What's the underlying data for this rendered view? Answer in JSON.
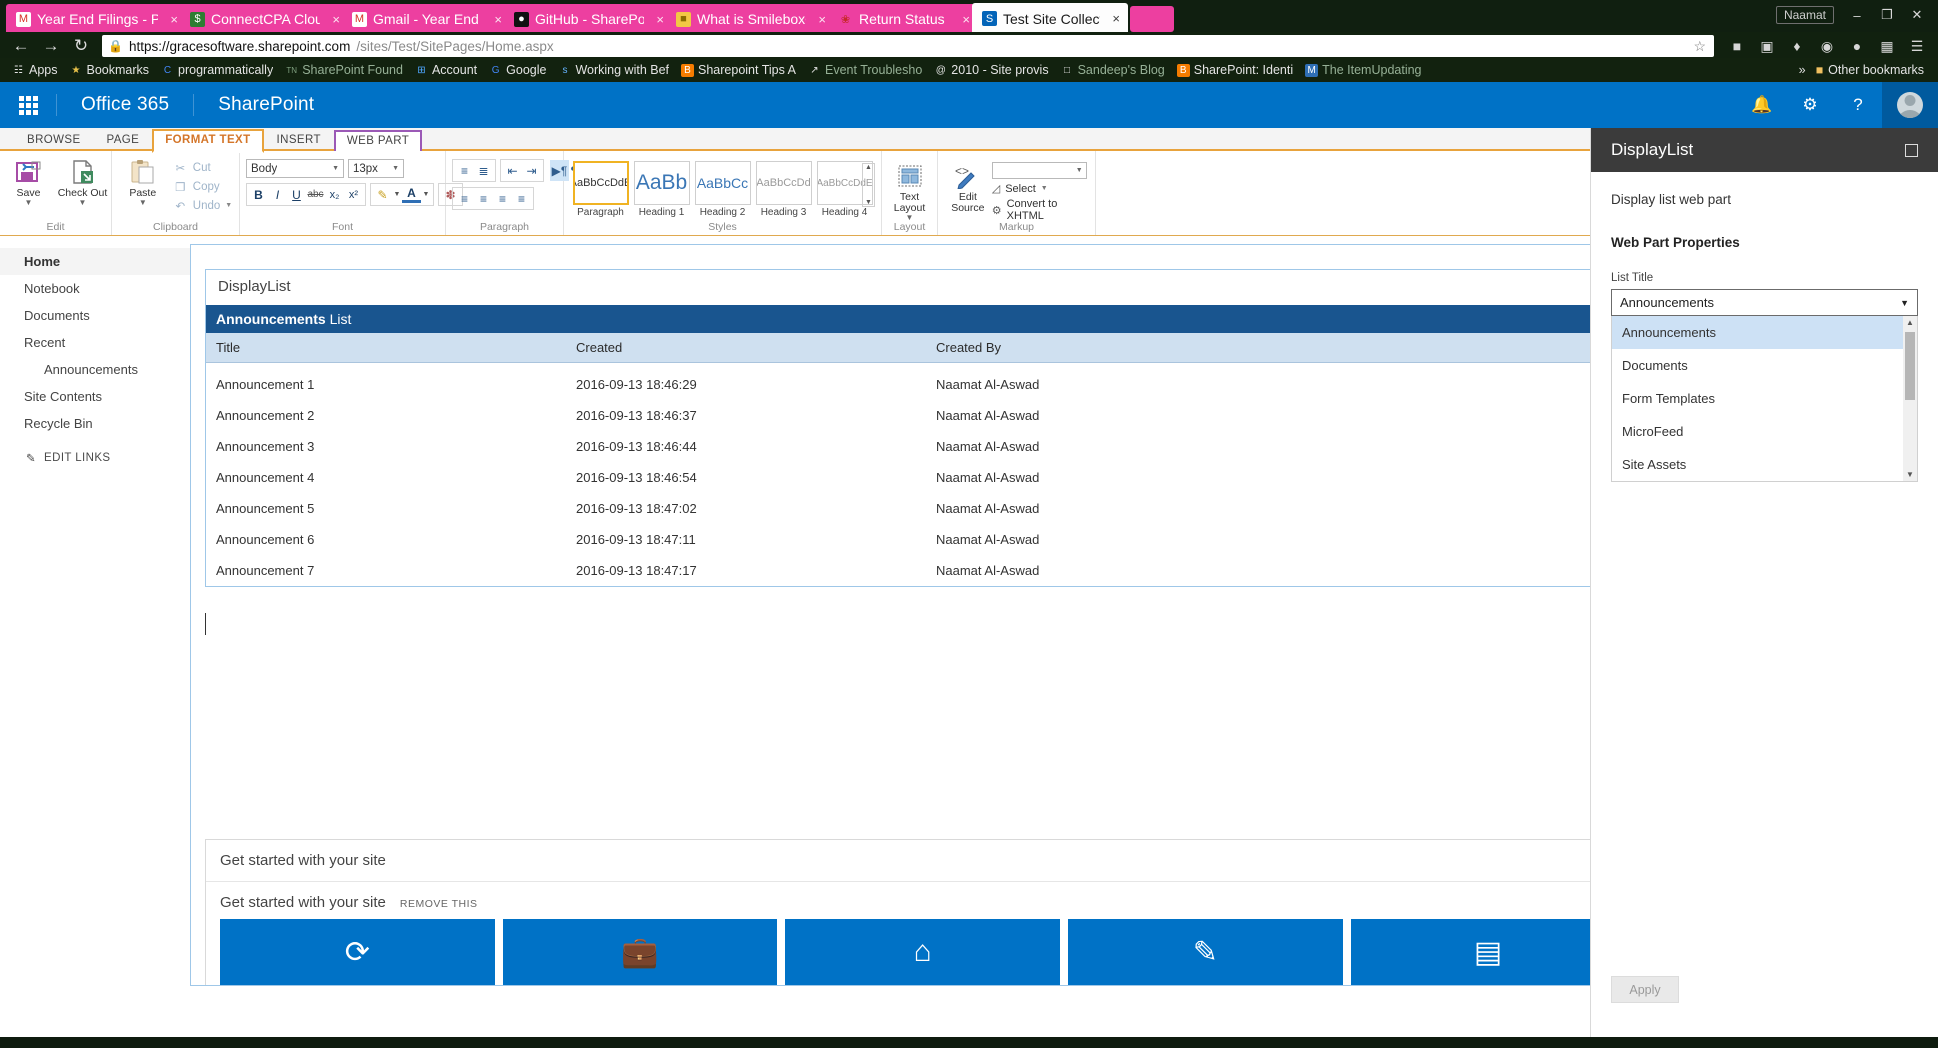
{
  "browser": {
    "tabs": [
      {
        "label": "Year End Filings - Pay",
        "icon": "gmail-icon",
        "icon_glyph": "M",
        "active": false
      },
      {
        "label": "ConnectCPA Cloud P",
        "icon": "dollar-icon",
        "icon_glyph": "$",
        "active": false
      },
      {
        "label": "Gmail - Year End Filin",
        "icon": "gmail-icon",
        "icon_glyph": "M",
        "active": false
      },
      {
        "label": "GitHub - SharePoint/",
        "icon": "github-icon",
        "icon_glyph": "●",
        "active": false
      },
      {
        "label": "What is SmileboxClie",
        "icon": "box-icon",
        "icon_glyph": "■",
        "active": false
      },
      {
        "label": "Return Status",
        "icon": "maple-leaf-icon",
        "icon_glyph": "❀",
        "active": false
      },
      {
        "label": "Test Site Collection -",
        "icon": "sharepoint-icon",
        "icon_glyph": "S",
        "active": true
      }
    ],
    "window": {
      "user": "Naamat",
      "minimize": "–",
      "restore": "❐",
      "close": "✕"
    },
    "nav": {
      "back": "←",
      "forward": "→",
      "reload": "↻",
      "bookmark_star": "☆"
    },
    "url": {
      "full": "https://gracesoftware.sharepoint.com/sites/Test/SitePages/Home.aspx",
      "base": "https://gracesoftware.sharepoint.com",
      "rest": "/sites/Test/SitePages/Home.aspx",
      "lock": "🔒"
    },
    "bookmarks": [
      {
        "label": "Apps",
        "icon": "apps-grid-icon",
        "glyph": "☷"
      },
      {
        "label": "Bookmarks",
        "icon": "star-icon",
        "glyph": "★"
      },
      {
        "label": "programmatically",
        "icon": "chrome-icon",
        "glyph": "C"
      },
      {
        "label": "SharePoint Found",
        "icon": "tn-icon",
        "glyph": "TN"
      },
      {
        "label": "Account",
        "icon": "microsoft-icon",
        "glyph": "⊞"
      },
      {
        "label": "Google",
        "icon": "chrome-icon",
        "glyph": "G"
      },
      {
        "label": "Working with Bef",
        "icon": "sp-icon",
        "glyph": "s"
      },
      {
        "label": "Sharepoint Tips A",
        "icon": "blogger-icon",
        "glyph": "B"
      },
      {
        "label": "Event Troublesho",
        "icon": "link-icon",
        "glyph": "↗"
      },
      {
        "label": "2010 - Site provis",
        "icon": "at-icon",
        "glyph": "@"
      },
      {
        "label": "Sandeep's Blog",
        "icon": "page-icon",
        "glyph": "□"
      },
      {
        "label": "SharePoint: Identi",
        "icon": "blogger-icon",
        "glyph": "B"
      },
      {
        "label": "The ItemUpdating",
        "icon": "m-icon",
        "glyph": "M"
      }
    ],
    "bookmarks_overflow": "»",
    "other_bookmarks": {
      "label": "Other bookmarks",
      "icon": "folder-icon",
      "glyph": "📁"
    }
  },
  "suite": {
    "waffle": "app-launcher-icon",
    "office": "Office 365",
    "product": "SharePoint",
    "icons": [
      {
        "name": "notifications-icon",
        "glyph": "🔔"
      },
      {
        "name": "settings-gear-icon",
        "glyph": "⚙"
      },
      {
        "name": "help-icon",
        "glyph": "?"
      }
    ],
    "avatar": "user-avatar"
  },
  "ribbon": {
    "tabs": [
      {
        "label": "BROWSE",
        "state": "normal"
      },
      {
        "label": "PAGE",
        "state": "normal"
      },
      {
        "label": "FORMAT TEXT",
        "state": "selected"
      },
      {
        "label": "INSERT",
        "state": "normal"
      },
      {
        "label": "WEB PART",
        "state": "contextual"
      }
    ],
    "groups": {
      "edit": {
        "label": "Edit",
        "save": {
          "label": "Save",
          "icon": "save-icon"
        },
        "checkout": {
          "label": "Check Out",
          "icon": "checkout-icon"
        }
      },
      "clipboard": {
        "label": "Clipboard",
        "paste": {
          "label": "Paste",
          "icon": "paste-icon"
        },
        "cut": {
          "label": "Cut",
          "icon": "scissors-icon"
        },
        "copy": {
          "label": "Copy",
          "icon": "copy-icon"
        },
        "undo": {
          "label": "Undo",
          "icon": "undo-icon"
        }
      },
      "font": {
        "label": "Font",
        "family": "Body",
        "size": "13px",
        "bold": "B",
        "italic": "I",
        "underline": "U",
        "strike": "abc",
        "subscript": "x₂",
        "superscript": "x²",
        "highlight": "highlight-icon",
        "fontcolor": "font-color-icon",
        "clearformat": "clear-format-icon"
      },
      "paragraph": {
        "label": "Paragraph",
        "buttons": [
          "bullet-list-icon",
          "numbered-list-icon",
          "decrease-indent-icon",
          "increase-indent-icon",
          "ltr-icon",
          "rtl-icon",
          "align-left-icon",
          "align-center-icon",
          "align-right-icon",
          "justify-icon"
        ]
      },
      "styles": {
        "label": "Styles",
        "items": [
          {
            "sample": "AaBbCcDdE",
            "label": "Paragraph",
            "selected": true,
            "size": 11
          },
          {
            "sample": "AaBb",
            "label": "Heading 1",
            "selected": false,
            "size": 21
          },
          {
            "sample": "AaBbCc",
            "label": "Heading 2",
            "selected": false,
            "size": 14
          },
          {
            "sample": "AaBbCcDd",
            "label": "Heading 3",
            "selected": false,
            "size": 11
          },
          {
            "sample": "AaBbCcDdE",
            "label": "Heading 4",
            "selected": false,
            "size": 10
          }
        ]
      },
      "layout": {
        "label": "Layout",
        "text_layout": {
          "label": "Text Layout",
          "icon": "text-layout-icon"
        }
      },
      "markup": {
        "label": "Markup",
        "edit_source": {
          "label": "Edit Source",
          "icon": "edit-source-icon"
        },
        "select": {
          "label": "Select",
          "icon": "select-icon"
        },
        "convert": {
          "label": "Convert to XHTML",
          "icon": "convert-icon"
        },
        "search_value": ""
      }
    }
  },
  "leftnav": {
    "items": [
      {
        "label": "Home",
        "selected": true,
        "sub": false
      },
      {
        "label": "Notebook",
        "selected": false,
        "sub": false
      },
      {
        "label": "Documents",
        "selected": false,
        "sub": false
      },
      {
        "label": "Recent",
        "selected": false,
        "sub": false
      },
      {
        "label": "Announcements",
        "selected": false,
        "sub": true
      },
      {
        "label": "Site Contents",
        "selected": false,
        "sub": false
      },
      {
        "label": "Recycle Bin",
        "selected": false,
        "sub": false
      }
    ],
    "edit_links": {
      "label": "EDIT LINKS",
      "icon": "pencil-icon"
    }
  },
  "webpart": {
    "title": "DisplayList",
    "list_header_bold": "Announcements",
    "list_header_rest": " List",
    "columns": [
      "Title",
      "Created",
      "Created By"
    ],
    "rows": [
      {
        "title": "Announcement 1",
        "created": "2016-09-13 18:46:29",
        "created_by": "Naamat Al-Aswad"
      },
      {
        "title": "Announcement 2",
        "created": "2016-09-13 18:46:37",
        "created_by": "Naamat Al-Aswad"
      },
      {
        "title": "Announcement 3",
        "created": "2016-09-13 18:46:44",
        "created_by": "Naamat Al-Aswad"
      },
      {
        "title": "Announcement 4",
        "created": "2016-09-13 18:46:54",
        "created_by": "Naamat Al-Aswad"
      },
      {
        "title": "Announcement 5",
        "created": "2016-09-13 18:47:02",
        "created_by": "Naamat Al-Aswad"
      },
      {
        "title": "Announcement 6",
        "created": "2016-09-13 18:47:11",
        "created_by": "Naamat Al-Aswad"
      },
      {
        "title": "Announcement 7",
        "created": "2016-09-13 18:47:17",
        "created_by": "Naamat Al-Aswad"
      }
    ]
  },
  "get_started": {
    "title_outer": "Get started with your site",
    "title_inner": "Get started with your site",
    "remove_label": "REMOVE THIS",
    "tiles": [
      {
        "icon": "share-site-icon",
        "glyph": "⟳"
      },
      {
        "icon": "working-on-icon",
        "glyph": "💼"
      },
      {
        "icon": "add-page-icon",
        "glyph": "⌂"
      },
      {
        "icon": "style-icon",
        "glyph": "✎"
      },
      {
        "icon": "title-logo-icon",
        "glyph": "▤"
      },
      {
        "icon": "add-app-icon",
        "glyph": "◰"
      }
    ]
  },
  "properties_panel": {
    "title": "DisplayList",
    "pin_icon": "pin-icon",
    "description": "Display list web part",
    "section": "Web Part Properties",
    "field_label": "List Title",
    "selected_value": "Announcements",
    "dropdown_open": true,
    "options": [
      {
        "label": "Announcements",
        "highlighted": true
      },
      {
        "label": "Documents",
        "highlighted": false
      },
      {
        "label": "Form Templates",
        "highlighted": false
      },
      {
        "label": "MicroFeed",
        "highlighted": false
      },
      {
        "label": "Site Assets",
        "highlighted": false
      }
    ],
    "scroll_up": "▲",
    "scroll_down": "▼",
    "apply_label": "Apply"
  },
  "colors": {
    "sharepoint_blue": "#0072c6",
    "list_header_blue": "#19558f",
    "table_header_blue": "#cfe0f0",
    "ribbon_orange": "#e8a33d",
    "webpart_purple": "#9b59b6",
    "panel_dark": "#3b3b3b",
    "highlight_blue": "#cde1f5",
    "tab_pink": "#ed3fa0"
  }
}
